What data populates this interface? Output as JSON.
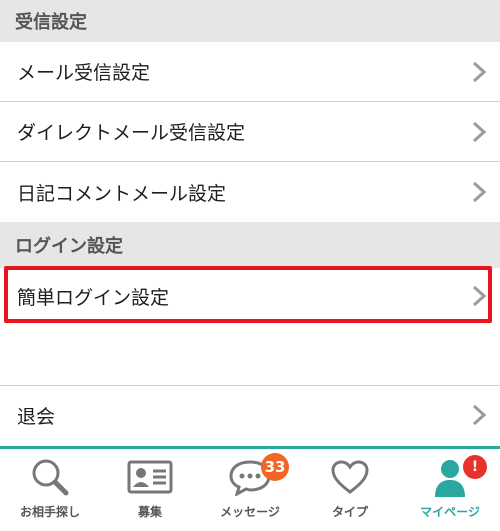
{
  "sections": {
    "reception": {
      "title": "受信設定",
      "items": [
        {
          "label": "メール受信設定"
        },
        {
          "label": "ダイレクトメール受信設定"
        },
        {
          "label": "日記コメントメール設定"
        }
      ]
    },
    "login": {
      "title": "ログイン設定",
      "items": [
        {
          "label": "簡単ログイン設定"
        }
      ]
    }
  },
  "withdraw": {
    "label": "退会"
  },
  "tabbar": {
    "items": [
      {
        "label": "お相手探し",
        "icon": "search-icon"
      },
      {
        "label": "募集",
        "icon": "id-card-icon"
      },
      {
        "label": "メッセージ",
        "icon": "chat-bubble-icon",
        "badge": "33"
      },
      {
        "label": "タイプ",
        "icon": "heart-icon"
      },
      {
        "label": "マイページ",
        "icon": "person-icon",
        "badge": "!",
        "active": true
      }
    ]
  },
  "colors": {
    "accent": "#2aa79f",
    "highlight": "#e8141f",
    "badge": "#f26522",
    "section_bg": "#e6e6e6"
  }
}
